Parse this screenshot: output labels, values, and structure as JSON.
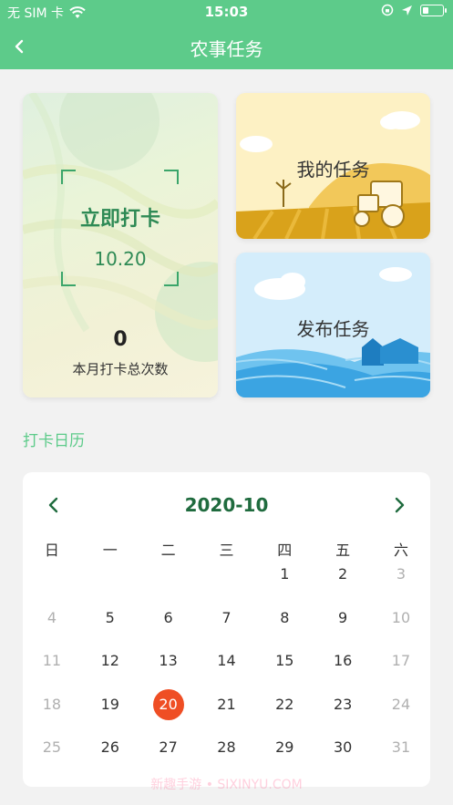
{
  "status_bar": {
    "carrier": "无 SIM 卡",
    "time": "15:03"
  },
  "nav": {
    "title": "农事任务",
    "back_icon": "chevron-left-icon"
  },
  "checkin_card": {
    "action": "立即打卡",
    "date": "10.20",
    "count": "0",
    "count_label": "本月打卡总次数"
  },
  "my_task": {
    "label": "我的任务"
  },
  "publish_task": {
    "label": "发布任务"
  },
  "calendar_section": {
    "title": "打卡日历"
  },
  "calendar": {
    "month": "2020-10",
    "weekdays": [
      "日",
      "一",
      "二",
      "三",
      "四",
      "五",
      "六"
    ],
    "weeks": [
      [
        "",
        "",
        "",
        "",
        "1",
        "2",
        "3"
      ],
      [
        "4",
        "5",
        "6",
        "7",
        "8",
        "9",
        "10"
      ],
      [
        "11",
        "12",
        "13",
        "14",
        "15",
        "16",
        "17"
      ],
      [
        "18",
        "19",
        "20",
        "21",
        "22",
        "23",
        "24"
      ],
      [
        "25",
        "26",
        "27",
        "28",
        "29",
        "30",
        "31"
      ]
    ],
    "selected_day": "20",
    "colors": {
      "accent": "#5dcb8a",
      "selected": "#ef4e24",
      "month_text": "#1f6b3e"
    }
  },
  "watermark": "新趣手游 • SIXINYU.COM"
}
